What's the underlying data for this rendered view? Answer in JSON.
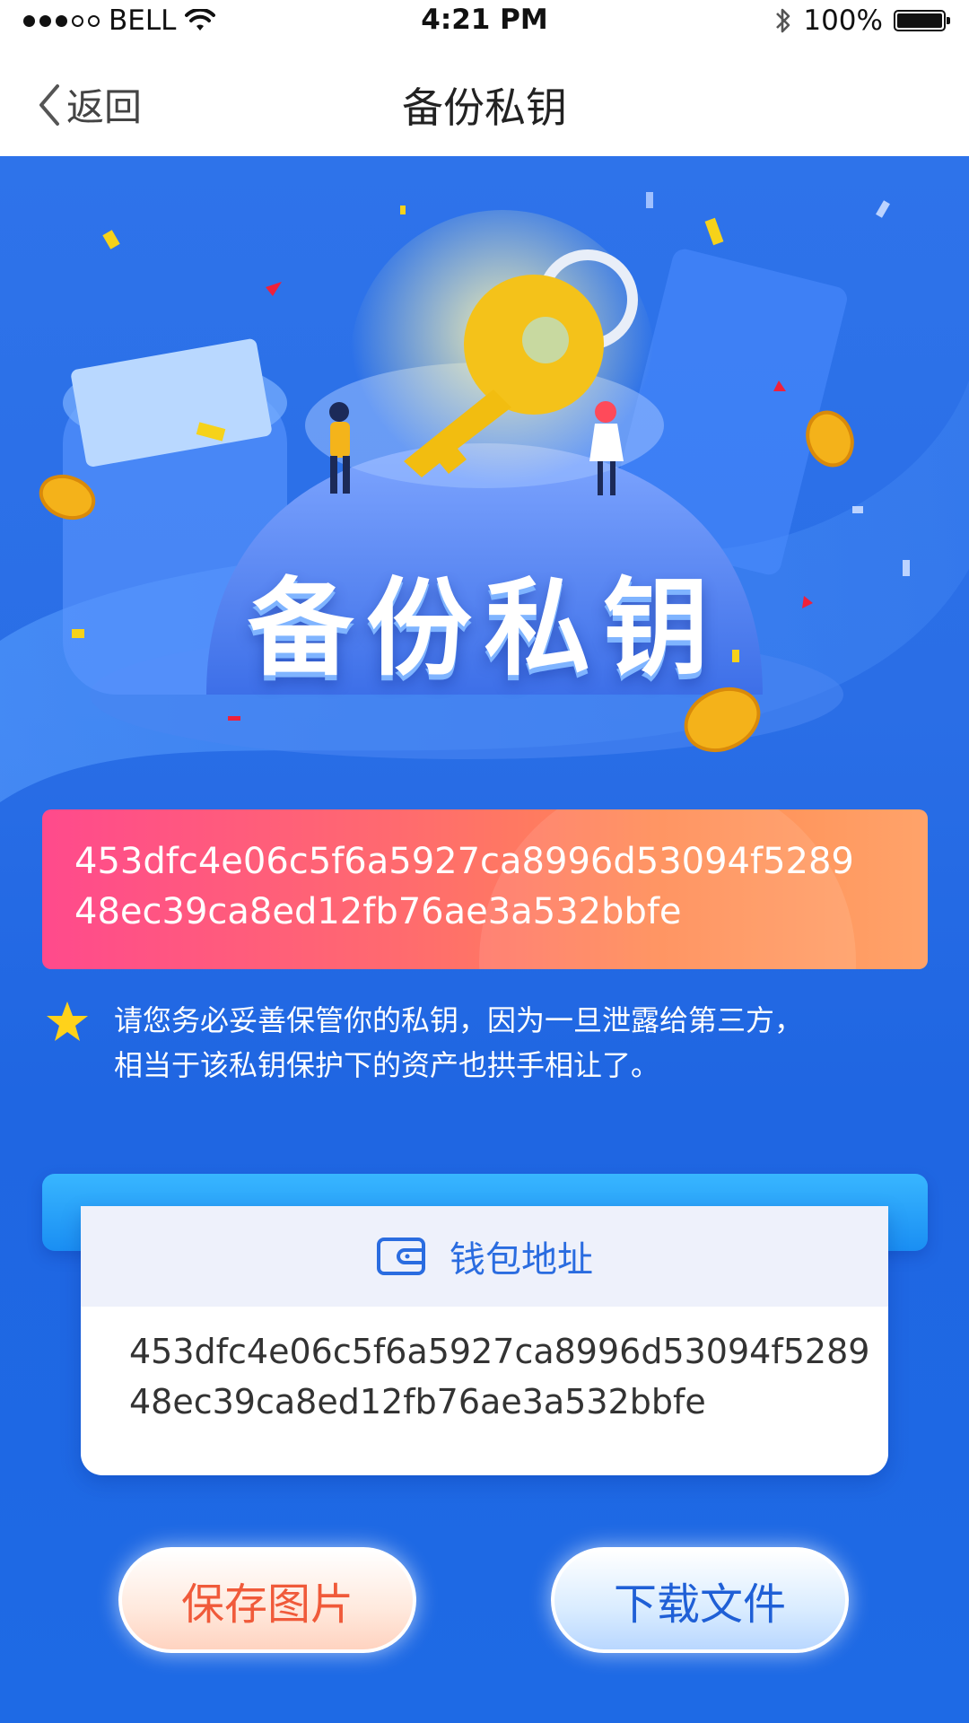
{
  "status_bar": {
    "carrier": "BELL",
    "time": "4:21 PM",
    "battery_text": "100%",
    "signal_bars_filled": 3,
    "signal_bars_total": 5
  },
  "nav": {
    "back_label": "返回",
    "title": "备份私钥"
  },
  "hero": {
    "title": "备份私钥"
  },
  "private_key": {
    "line1": "453dfc4e06c5f6a5927ca8996d53094f5289",
    "line2": "48ec39ca8ed12fb76ae3a532bbfe"
  },
  "warning": {
    "line1": "请您务必妥善保管你的私钥，因为一旦泄露给第三方，",
    "line2": "相当于该私钥保护下的资产也拱手相让了。"
  },
  "wallet": {
    "label": "钱包地址",
    "address_line1": "453dfc4e06c5f6a5927ca8996d53094f5289",
    "address_line2": "48ec39ca8ed12fb76ae3a532bbfe"
  },
  "buttons": {
    "save_label": "保存图片",
    "download_label": "下载文件"
  },
  "colors": {
    "primary_blue": "#2a6ee6",
    "key_gradient_start": "#ff4a8c",
    "key_gradient_end": "#ffa36a",
    "save_text": "#f05a3a",
    "download_text": "#1f5fd6"
  },
  "icons": [
    "chevron-left-icon",
    "wifi-icon",
    "bluetooth-icon",
    "battery-icon",
    "star-icon",
    "wallet-icon"
  ]
}
